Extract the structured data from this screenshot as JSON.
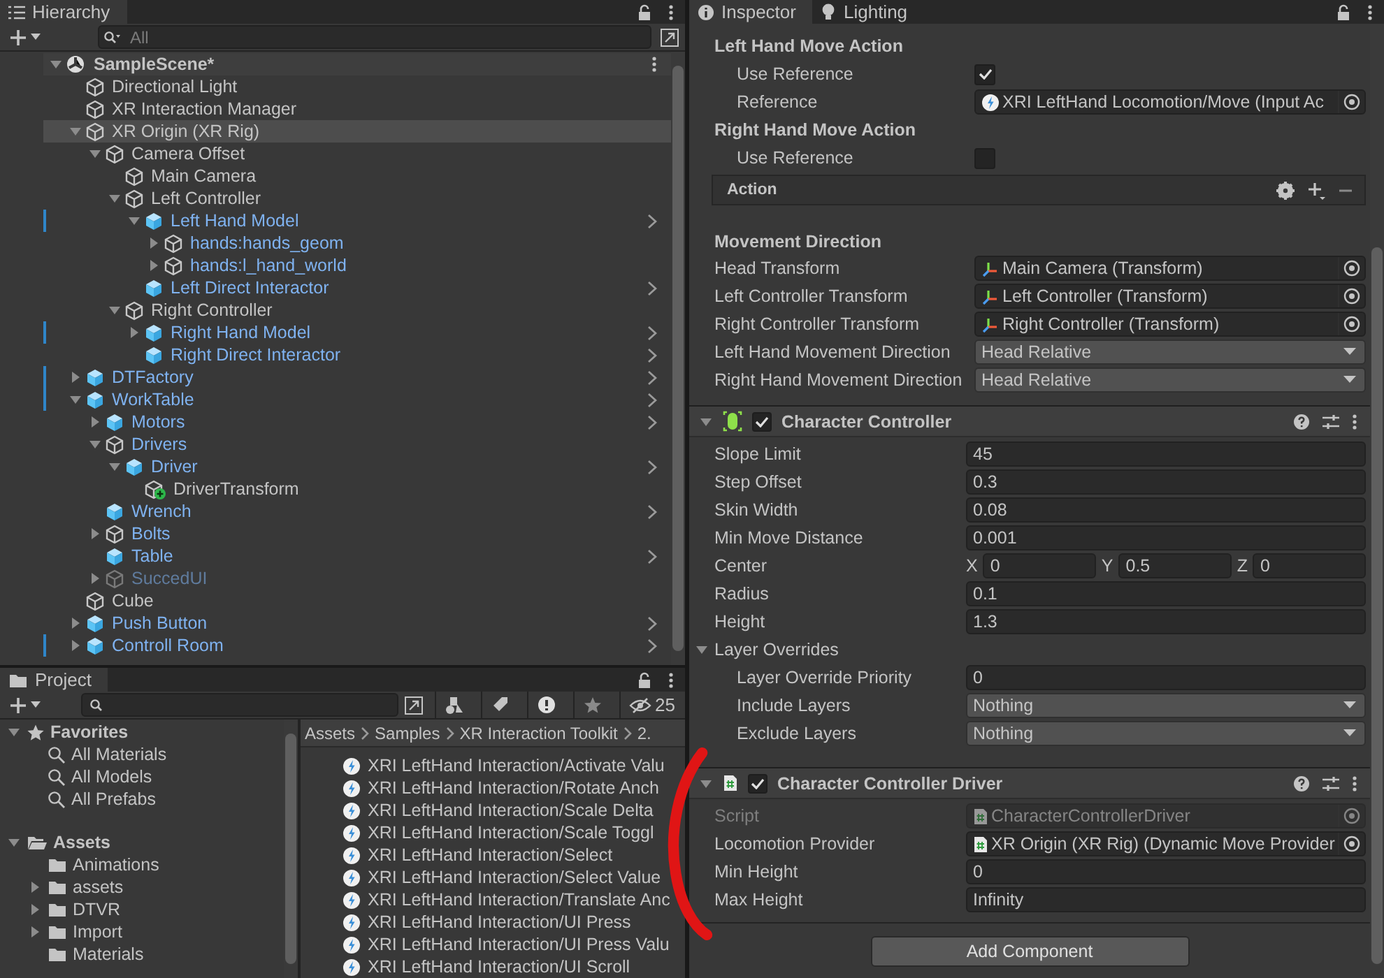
{
  "hierarchy": {
    "tab": "Hierarchy",
    "search": {
      "placeholder": "All"
    },
    "scene": {
      "name": "SampleScene*",
      "expanded": true,
      "children": [
        {
          "name": "Directional Light",
          "kind": "cube",
          "prefab": false,
          "override": false,
          "active": true,
          "selected": false
        },
        {
          "name": "XR Interaction Manager",
          "kind": "cube",
          "prefab": false,
          "override": false,
          "active": true,
          "selected": false
        },
        {
          "name": "XR Origin (XR Rig)",
          "kind": "cube",
          "prefab": false,
          "override": false,
          "active": true,
          "selected": true,
          "expanded": true,
          "children": [
            {
              "name": "Camera Offset",
              "kind": "cube",
              "prefab": false,
              "override": false,
              "active": true,
              "selected": false,
              "expanded": true,
              "children": [
                {
                  "name": "Main Camera",
                  "kind": "cube",
                  "prefab": false,
                  "override": false,
                  "active": true,
                  "selected": false
                },
                {
                  "name": "Left Controller",
                  "kind": "cube",
                  "prefab": false,
                  "override": false,
                  "active": true,
                  "selected": false,
                  "expanded": true,
                  "children": [
                    {
                      "name": "Left Hand Model",
                      "kind": "prefab",
                      "prefab": true,
                      "override": true,
                      "active": true,
                      "selected": false,
                      "expanded": true,
                      "children": [
                        {
                          "name": "hands:hands_geom",
                          "kind": "cube",
                          "prefab": true,
                          "override": false,
                          "active": true,
                          "selected": false,
                          "expanded": false
                        },
                        {
                          "name": "hands:l_hand_world",
                          "kind": "cube",
                          "prefab": true,
                          "override": false,
                          "active": true,
                          "selected": false,
                          "expanded": false
                        }
                      ]
                    },
                    {
                      "name": "Left Direct Interactor",
                      "kind": "prefab",
                      "prefab": true,
                      "override": false,
                      "active": true,
                      "selected": false
                    }
                  ]
                },
                {
                  "name": "Right Controller",
                  "kind": "cube",
                  "prefab": false,
                  "override": false,
                  "active": true,
                  "selected": false,
                  "expanded": true,
                  "children": [
                    {
                      "name": "Right Hand Model",
                      "kind": "prefab",
                      "prefab": true,
                      "override": true,
                      "active": true,
                      "selected": false,
                      "expanded": false
                    },
                    {
                      "name": "Right Direct Interactor",
                      "kind": "prefab",
                      "prefab": true,
                      "override": false,
                      "active": true,
                      "selected": false
                    }
                  ]
                }
              ]
            }
          ]
        },
        {
          "name": "DTFactory",
          "kind": "prefab",
          "prefab": true,
          "override": true,
          "active": true,
          "selected": false,
          "expanded": false
        },
        {
          "name": "WorkTable",
          "kind": "prefab",
          "prefab": true,
          "override": true,
          "active": true,
          "selected": false,
          "expanded": true,
          "children": [
            {
              "name": "Motors",
              "kind": "prefab",
              "prefab": true,
              "override": false,
              "active": true,
              "selected": false,
              "expanded": false
            },
            {
              "name": "Drivers",
              "kind": "cube",
              "prefab": true,
              "override": false,
              "active": true,
              "selected": false,
              "expanded": true,
              "children": [
                {
                  "name": "Driver",
                  "kind": "prefab",
                  "prefab": true,
                  "override": false,
                  "active": true,
                  "selected": false,
                  "expanded": true,
                  "children": [
                    {
                      "name": "DriverTransform",
                      "kind": "added",
                      "prefab": false,
                      "override": false,
                      "active": true,
                      "selected": false
                    }
                  ]
                }
              ]
            },
            {
              "name": "Wrench",
              "kind": "prefab",
              "prefab": true,
              "override": false,
              "active": true,
              "selected": false
            },
            {
              "name": "Bolts",
              "kind": "cube",
              "prefab": true,
              "override": false,
              "active": true,
              "selected": false,
              "expanded": false
            },
            {
              "name": "Table",
              "kind": "prefab",
              "prefab": true,
              "override": false,
              "active": true,
              "selected": false
            },
            {
              "name": "SuccedUI",
              "kind": "cube",
              "prefab": true,
              "override": false,
              "active": false,
              "selected": false,
              "expanded": false
            }
          ]
        },
        {
          "name": "Cube",
          "kind": "cube",
          "prefab": false,
          "override": false,
          "active": true,
          "selected": false
        },
        {
          "name": "Push Button",
          "kind": "prefab",
          "prefab": true,
          "override": false,
          "active": true,
          "selected": false,
          "expanded": false
        },
        {
          "name": "Controll Room",
          "kind": "prefab",
          "prefab": true,
          "override": true,
          "active": true,
          "selected": false,
          "expanded": false
        }
      ]
    }
  },
  "project": {
    "tab": "Project",
    "hidden_count": "25",
    "tree": [
      {
        "label": "Favorites",
        "kind": "favorites",
        "expanded": true,
        "children": [
          {
            "label": "All Materials",
            "kind": "search"
          },
          {
            "label": "All Models",
            "kind": "search"
          },
          {
            "label": "All Prefabs",
            "kind": "search"
          }
        ]
      },
      {
        "label": "Assets",
        "kind": "folder",
        "expanded": true,
        "children": [
          {
            "label": "Animations",
            "kind": "folder"
          },
          {
            "label": "assets",
            "kind": "folder",
            "expanded": false
          },
          {
            "label": "DTVR",
            "kind": "folder",
            "expanded": false
          },
          {
            "label": "Import",
            "kind": "folder",
            "expanded": false
          },
          {
            "label": "Materials",
            "kind": "folder"
          }
        ]
      }
    ],
    "breadcrumb": [
      "Assets",
      "Samples",
      "XR Interaction Toolkit",
      "2."
    ],
    "files": [
      "XRI LeftHand Interaction/Activate Valu",
      "XRI LeftHand Interaction/Rotate Anch",
      "XRI LeftHand Interaction/Scale Delta",
      "XRI LeftHand Interaction/Scale Toggl",
      "XRI LeftHand Interaction/Select",
      "XRI LeftHand Interaction/Select Value",
      "XRI LeftHand Interaction/Translate Anc",
      "XRI LeftHand Interaction/UI Press",
      "XRI LeftHand Interaction/UI Press Valu",
      "XRI LeftHand Interaction/UI Scroll"
    ]
  },
  "inspector": {
    "tabs": [
      {
        "label": "Inspector",
        "selected": true
      },
      {
        "label": "Lighting",
        "selected": false
      }
    ],
    "rows": [
      {
        "kind": "heading",
        "label": "Left Hand Move Action",
        "children": [
          {
            "kind": "checkbox",
            "label": "Use Reference",
            "checked": true
          },
          {
            "kind": "reference",
            "label": "Reference",
            "value": "XRI LeftHand Locomotion/Move (Input Ac",
            "disabled": false
          }
        ]
      },
      {
        "kind": "heading",
        "label": "Right Hand Move Action",
        "children": [
          {
            "kind": "checkbox",
            "label": "Use Reference",
            "checked": false
          },
          {
            "kind": "action-box",
            "label": "Action"
          }
        ]
      },
      {
        "kind": "heading",
        "label": "Movement Direction"
      },
      {
        "kind": "transform",
        "label": "Head Transform",
        "value": "Main Camera (Transform)",
        "disabled": false
      },
      {
        "kind": "transform",
        "label": "Left Controller Transform",
        "value": "Left Controller (Transform)",
        "disabled": false
      },
      {
        "kind": "transform",
        "label": "Right Controller Transform",
        "value": "Right Controller (Transform)",
        "disabled": false
      },
      {
        "kind": "dropdown",
        "label": "Left Hand Movement Direction",
        "value": "Head Relative"
      },
      {
        "kind": "dropdown",
        "label": "Right Hand Movement Direction",
        "value": "Head Relative"
      },
      {
        "kind": "collider",
        "title": "Character Controller",
        "enabled": true,
        "expanded": true,
        "children": [
          {
            "kind": "text",
            "label": "Slope Limit",
            "value": "45"
          },
          {
            "kind": "text",
            "label": "Step Offset",
            "value": "0.3"
          },
          {
            "kind": "text",
            "label": "Skin Width",
            "value": "0.08"
          },
          {
            "kind": "text",
            "label": "Min Move Distance",
            "value": "0.001"
          },
          {
            "kind": "vector3",
            "label": "Center",
            "values": [
              {
                "axis": "X",
                "value": "0"
              },
              {
                "axis": "Y",
                "value": "0.5"
              },
              {
                "axis": "Z",
                "value": "0"
              }
            ]
          },
          {
            "kind": "text",
            "label": "Radius",
            "value": "0.1"
          },
          {
            "kind": "text",
            "label": "Height",
            "value": "1.3"
          },
          {
            "kind": "foldout",
            "label": "Layer Overrides",
            "expanded": true,
            "children": [
              {
                "kind": "text",
                "label": "Layer Override Priority",
                "value": "0"
              },
              {
                "kind": "dropdown",
                "label": "Include Layers",
                "value": "Nothing"
              },
              {
                "kind": "dropdown",
                "label": "Exclude Layers",
                "value": "Nothing"
              }
            ]
          }
        ]
      },
      {
        "kind": "behaviour",
        "title": "Character Controller Driver",
        "enabled": true,
        "expanded": true,
        "children": [
          {
            "kind": "script",
            "label": "Script",
            "value": "CharacterControllerDriver",
            "disabled": true
          },
          {
            "kind": "script",
            "label": "Locomotion Provider",
            "value": "XR Origin (XR Rig) (Dynamic Move Provider",
            "disabled": false
          },
          {
            "kind": "text",
            "label": "Min Height",
            "value": "0"
          },
          {
            "kind": "text",
            "label": "Max Height",
            "value": "Infinity"
          }
        ]
      }
    ],
    "add_button": "Add Component"
  }
}
